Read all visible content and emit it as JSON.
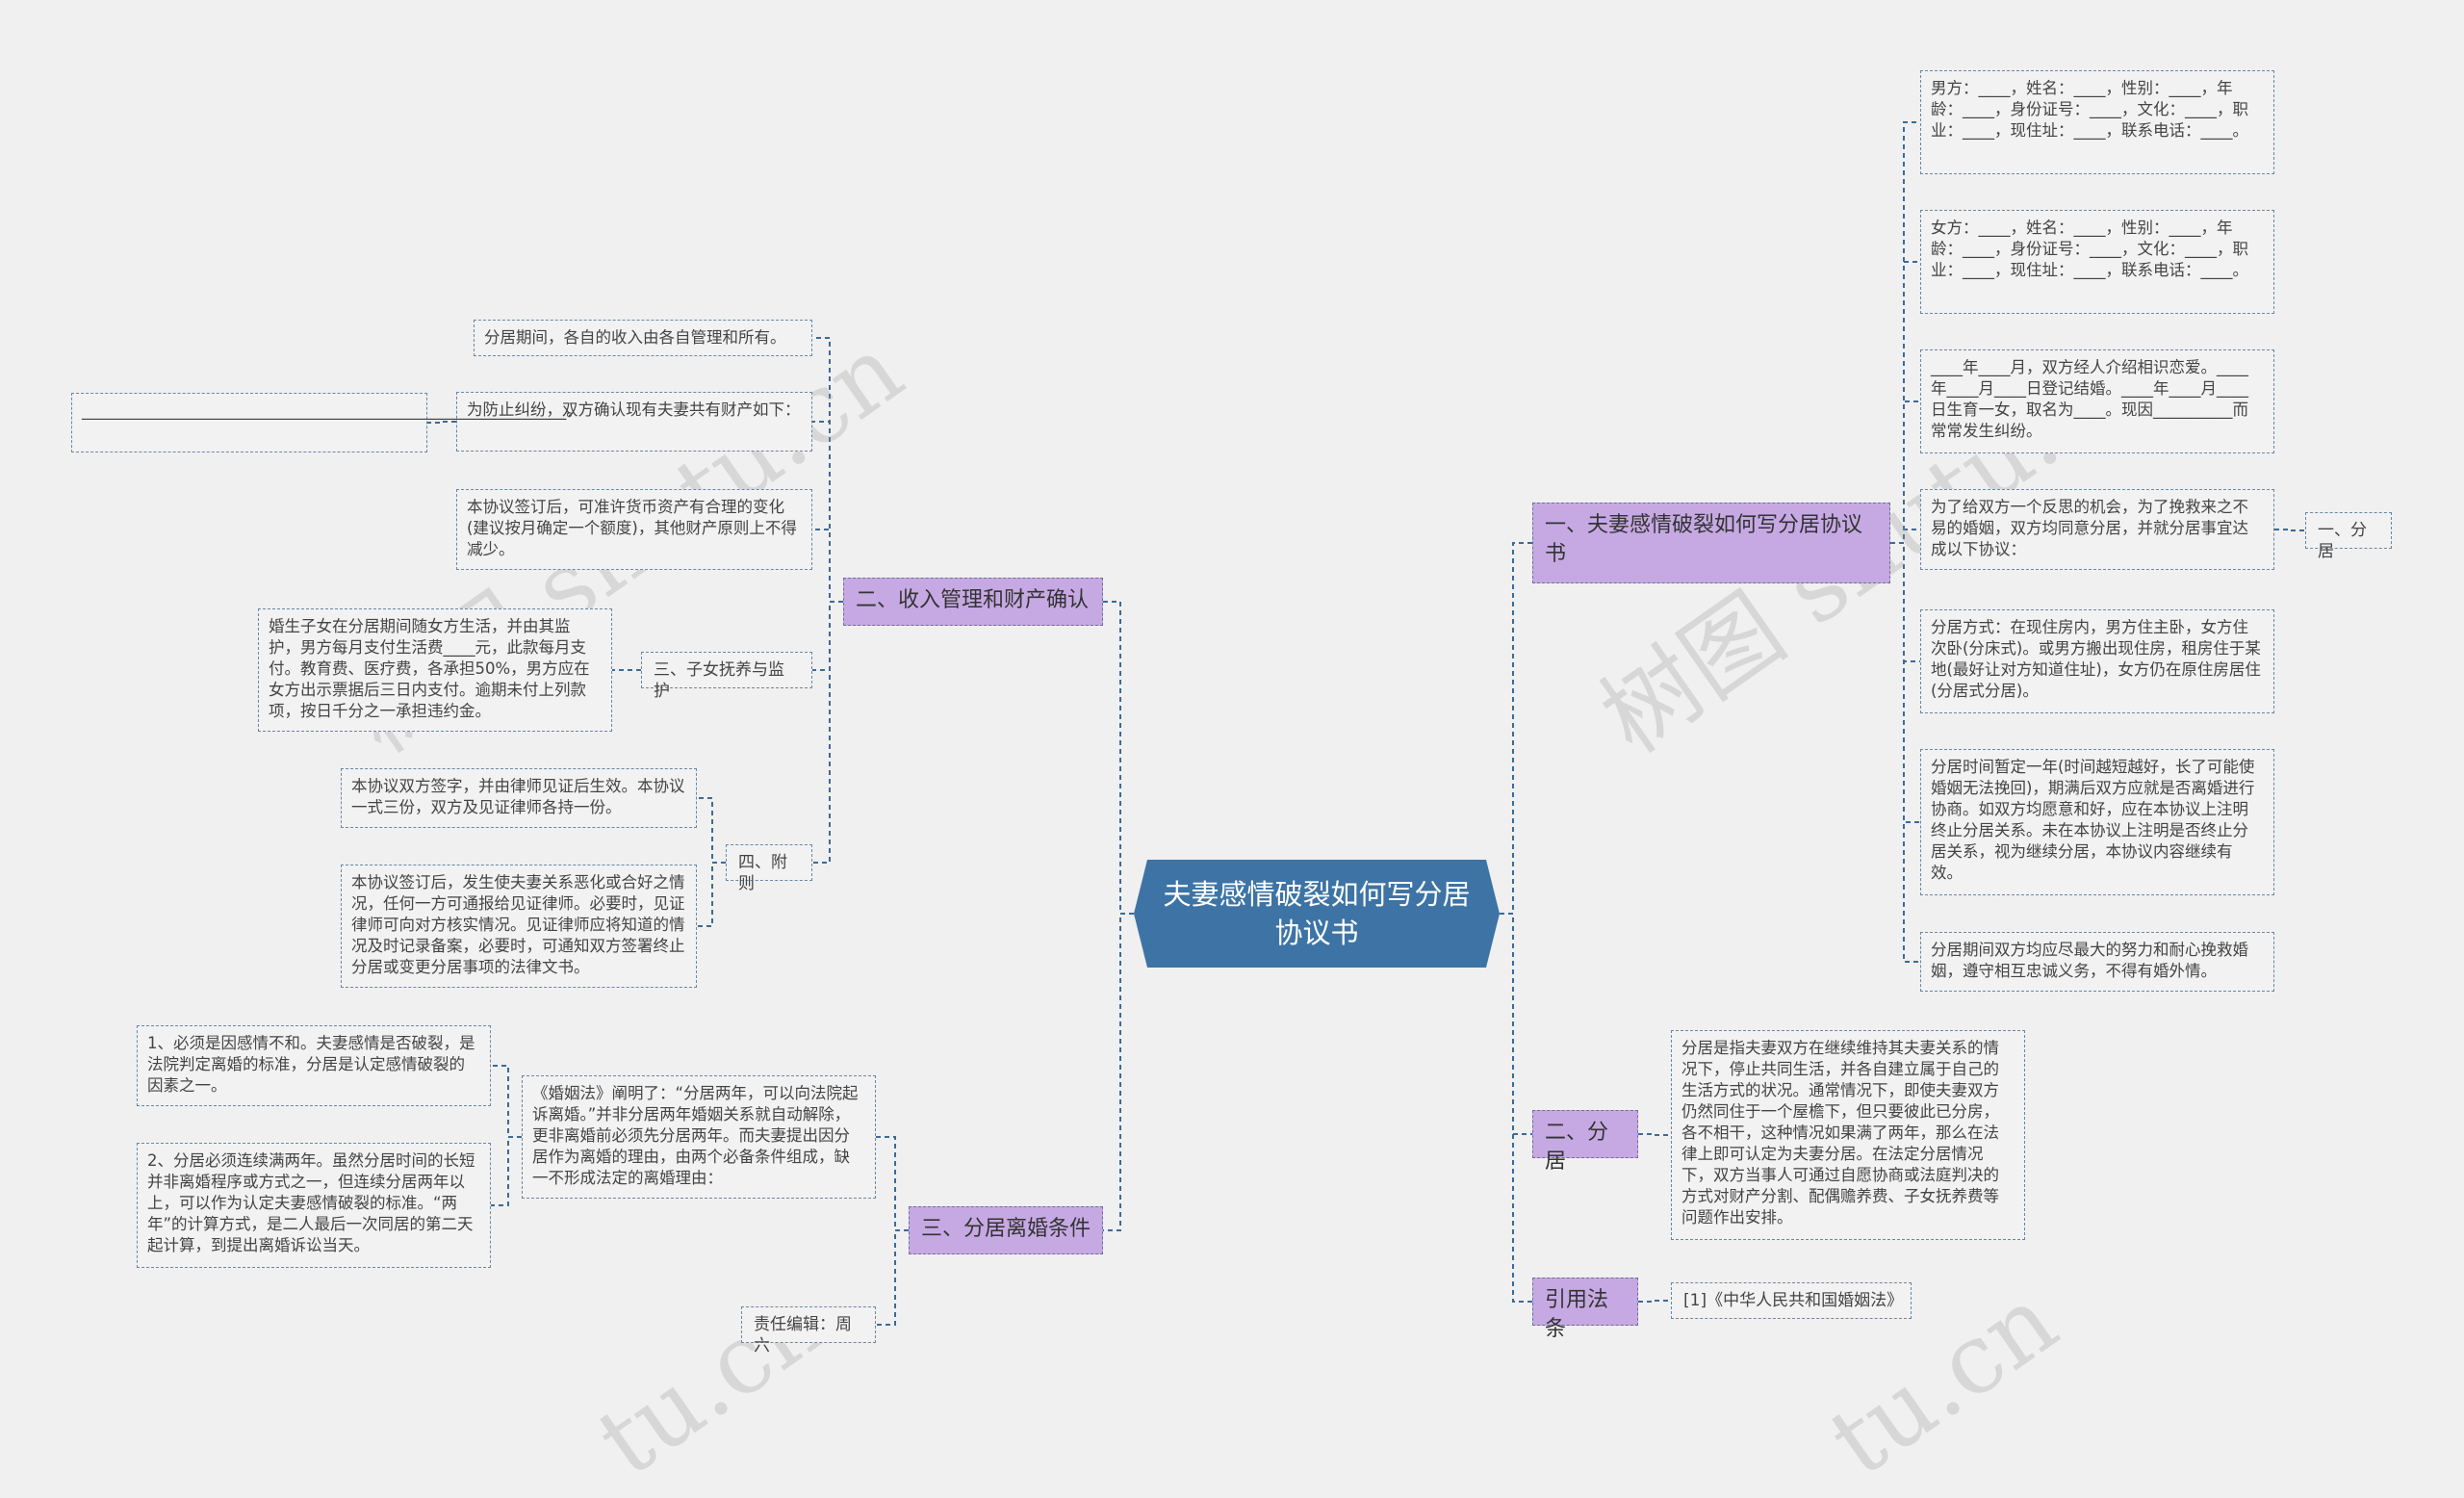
{
  "center": "夫妻感情破裂如何写分居协议书",
  "right": {
    "b1": {
      "label": "一、夫妻感情破裂如何写分居协议书",
      "l1": "男方：____，姓名：____，性别：____，年龄：____，身份证号：____，文化：____，职业：____，现住址：____，联系电话：____。",
      "l2": "女方：____，姓名：____，性别：____，年龄：____，身份证号：____，文化：____，职业：____，现住址：____，联系电话：____。",
      "l3": "____年____月，双方经人介绍相识恋爱。____年____月____日登记结婚。____年____月____日生育一女，取名为____。现因__________而常常发生纠纷。",
      "l4": "为了给双方一个反思的机会，为了挽救来之不易的婚姻，双方均同意分居，并就分居事宜达成以下协议：",
      "l4_child": "一、分居",
      "l5": "分居方式：在现住房内，男方住主卧，女方住次卧(分床式)。或男方搬出现住房，租房住于某地(最好让对方知道住址)，女方仍在原住房居住(分居式分居)。",
      "l6": "分居时间暂定一年(时间越短越好，长了可能使婚姻无法挽回)，期满后双方应就是否离婚进行协商。如双方均愿意和好，应在本协议上注明终止分居关系。未在本协议上注明是否终止分居关系，视为继续分居，本协议内容继续有效。",
      "l7": "分居期间双方均应尽最大的努力和耐心挽救婚姻，遵守相互忠诚义务，不得有婚外情。"
    },
    "b2": {
      "label": "二、分居",
      "l1": "分居是指夫妻双方在继续维持其夫妻关系的情况下，停止共同生活，并各自建立属于自己的生活方式的状况。通常情况下，即使夫妻双方仍然同住于一个屋檐下，但只要彼此已分房，各不相干，这种情况如果满了两年，那么在法律上即可认定为夫妻分居。在法定分居情况下，双方当事人可通过自愿协商或法庭判决的方式对财产分割、配偶赡养费、子女抚养费等问题作出安排。"
    },
    "b3": {
      "label": "引用法条",
      "l1": "[1]《中华人民共和国婚姻法》"
    }
  },
  "left": {
    "b1": {
      "label": "二、收入管理和财产确认",
      "l1": "分居期间，各自的收入由各自管理和所有。",
      "l2": "为防止纠纷，双方确认现有夫妻共有财产如下：",
      "l2_child": "_____________________________________________________________。",
      "l3": "本协议签订后，可准许货币资产有合理的变化(建议按月确定一个额度)，其他财产原则上不得减少。",
      "sub": "三、子女抚养与监护",
      "sub_child": "婚生子女在分居期间随女方生活，并由其监护，男方每月支付生活费____元，此款每月支付。教育费、医疗费，各承担50%，男方应在女方出示票据后三日内支付。逾期未付上列款项，按日千分之一承担违约金。",
      "sub2": "四、附则",
      "sub2_c1": "本协议双方签字，并由律师见证后生效。本协议一式三份，双方及见证律师各持一份。",
      "sub2_c2": "本协议签订后，发生使夫妻关系恶化或合好之情况，任何一方可通报给见证律师。必要时，见证律师可向对方核实情况。见证律师应将知道的情况及时记录备案，必要时，可通知双方签署终止分居或变更分居事项的法律文书。"
    },
    "b2": {
      "label": "三、分居离婚条件",
      "l1": "《婚姻法》阐明了：“分居两年，可以向法院起诉离婚。”并非分居两年婚姻关系就自动解除，更非离婚前必须先分居两年。而夫妻提出因分居作为离婚的理由，由两个必备条件组成，缺一不形成法定的离婚理由：",
      "c1": "1、必须是因感情不和。夫妻感情是否破裂，是法院判定离婚的标准，分居是认定感情破裂的因素之一。",
      "c2": "2、分居必须连续满两年。虽然分居时间的长短并非离婚程序或方式之一，但连续分居两年以上，可以作为认定夫妻感情破裂的标准。“两年”的计算方式，是二人最后一次同居的第二天起计算，到提出离婚诉讼当天。",
      "l2": "责任编辑：周六"
    }
  },
  "watermark": [
    "树图 shutu.cn",
    "树图 shutu.cn",
    "tu.cn",
    "tu.cn"
  ],
  "colors": {
    "center": "#3d74a5",
    "branch": "#c6a9e3",
    "line": "#3d6a96"
  }
}
